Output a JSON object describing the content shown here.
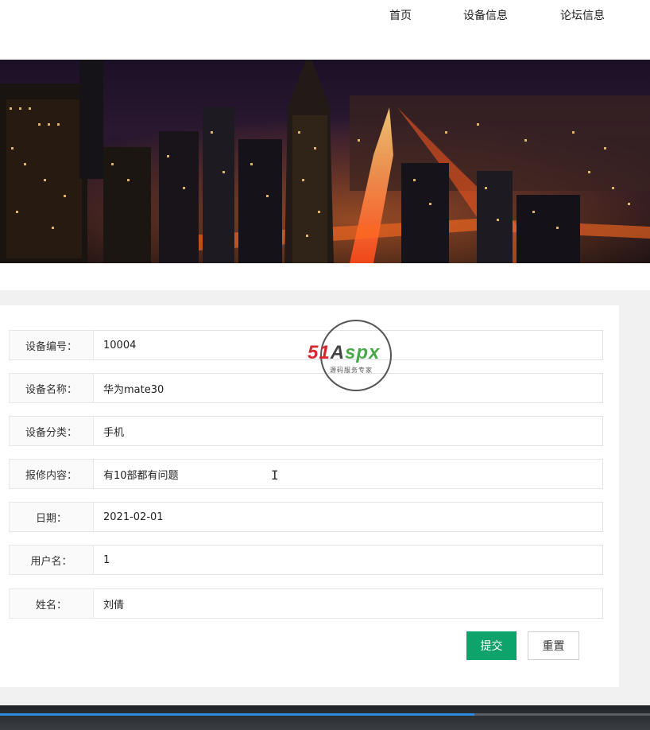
{
  "nav": {
    "items": [
      {
        "label": "首页"
      },
      {
        "label": "设备信息"
      },
      {
        "label": "论坛信息"
      }
    ]
  },
  "form": {
    "fields": [
      {
        "label": "设备编号：",
        "value": "10004"
      },
      {
        "label": "设备名称：",
        "value": "华为mate30"
      },
      {
        "label": "设备分类：",
        "value": "手机"
      },
      {
        "label": "报修内容：",
        "value": "有10部都有问题"
      },
      {
        "label": "日期：",
        "value": "2021-02-01"
      },
      {
        "label": "用户名：",
        "value": "1"
      },
      {
        "label": "姓名：",
        "value": "刘倩"
      }
    ],
    "submit_label": "提交",
    "reset_label": "重置"
  },
  "watermark": {
    "brand_51": "51",
    "brand_a": "A",
    "brand_spx": "spx",
    "tagline": "源码服务专家"
  },
  "video": {
    "progress": 0.73
  },
  "colors": {
    "accent": "#0ea36a",
    "progress": "#2d8ce0"
  }
}
